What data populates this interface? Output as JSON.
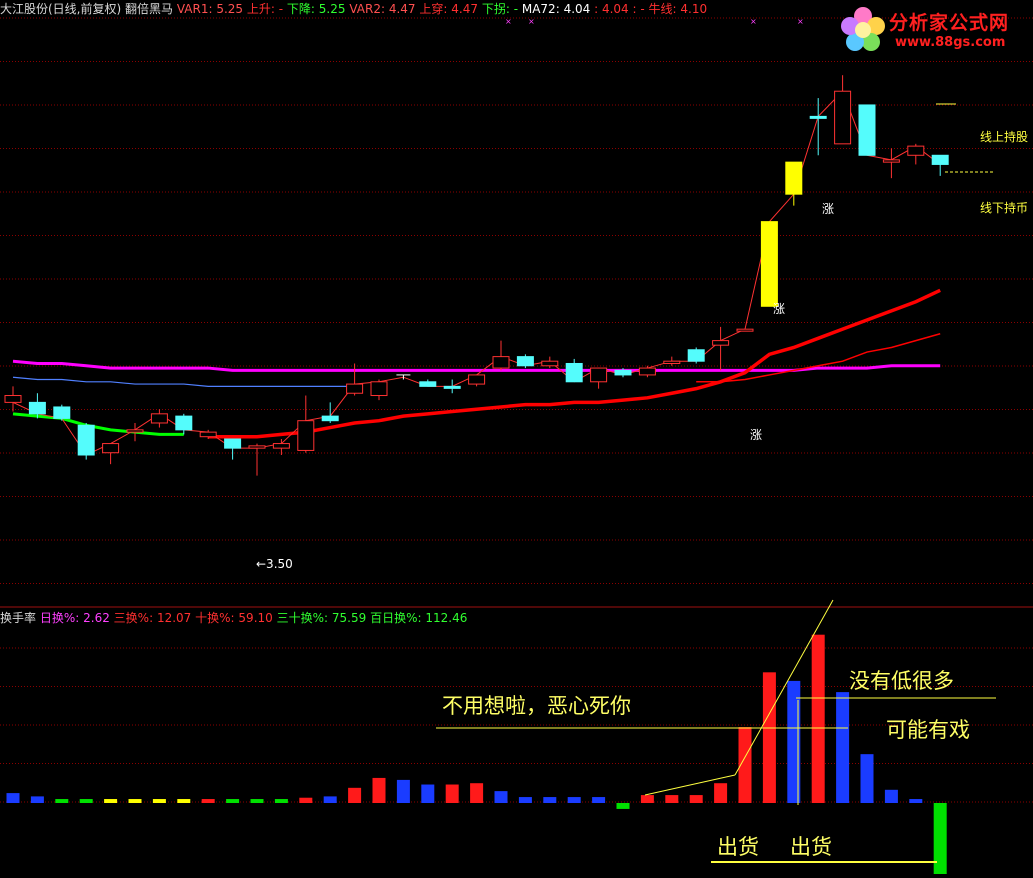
{
  "header": {
    "title": "大江股份(日线,前复权) 翻倍黑马",
    "var1_label": "VAR1:",
    "var1_value": "5.25",
    "up_label": "上升:",
    "up_value": "-",
    "down_label": "下降:",
    "down_value": "5.25",
    "var2_label": "VAR2:",
    "var2_value": "4.47",
    "rise_label": "上穿:",
    "rise_value": "4.47",
    "drop_label": "下拐:",
    "drop_value": "-",
    "ma72_label": "MA72:",
    "ma72_value": "4.04",
    "extra1": ": 4.04",
    "extra2": ": -",
    "bull_label": "牛线:",
    "bull_value": "4.10"
  },
  "sub_header": {
    "title": "换手率",
    "d1_label": "日换%:",
    "d1_value": "2.62",
    "d3_label": "三换%:",
    "d3_value": "12.07",
    "d10_label": "十换%:",
    "d10_value": "59.10",
    "d30_label": "三十换%:",
    "d30_value": "75.59",
    "d100_label": "百日换%:",
    "d100_value": "112.46"
  },
  "logo": {
    "text": "分析家公式网",
    "url": "www.88gs.com"
  },
  "labels": {
    "low_price": "←3.50",
    "zhang1": "涨",
    "zhang2": "涨",
    "zhang3": "涨",
    "hold_stock": "线上持股",
    "hold_cash": "线下持币"
  },
  "annotations": {
    "no_think": "不用想啦，恶心死你",
    "not_low": "没有低很多",
    "maybe": "可能有戏",
    "sell1": "出货",
    "sell2": "出货"
  },
  "colors": {
    "up": "#ff3232",
    "down": "#54fcfc",
    "signal": "#ffff00",
    "ma_purple": "#ff00ff",
    "ma_red": "#ff0000",
    "blue_line": "#5080ff",
    "grid": "#8b0000",
    "green": "#00ff00",
    "yellow_text": "#ffff66"
  },
  "chart_data": [
    {
      "type": "candlestick",
      "title": "大江股份(日线,前复权) 翻倍黑马",
      "ylim": [
        3.0,
        5.5
      ],
      "candles": [
        {
          "o": 3.85,
          "h": 3.89,
          "l": 3.78,
          "c": 3.82,
          "kind": "up"
        },
        {
          "o": 3.82,
          "h": 3.86,
          "l": 3.75,
          "c": 3.77,
          "kind": "down"
        },
        {
          "o": 3.8,
          "h": 3.81,
          "l": 3.74,
          "c": 3.75,
          "kind": "down"
        },
        {
          "o": 3.72,
          "h": 3.73,
          "l": 3.57,
          "c": 3.59,
          "kind": "down"
        },
        {
          "o": 3.6,
          "h": 3.64,
          "l": 3.55,
          "c": 3.64,
          "kind": "up"
        },
        {
          "o": 3.69,
          "h": 3.73,
          "l": 3.65,
          "c": 3.7,
          "kind": "up"
        },
        {
          "o": 3.73,
          "h": 3.79,
          "l": 3.71,
          "c": 3.77,
          "kind": "up"
        },
        {
          "o": 3.76,
          "h": 3.77,
          "l": 3.68,
          "c": 3.7,
          "kind": "down"
        },
        {
          "o": 3.67,
          "h": 3.7,
          "l": 3.66,
          "c": 3.69,
          "kind": "up"
        },
        {
          "o": 3.66,
          "h": 3.66,
          "l": 3.57,
          "c": 3.62,
          "kind": "down"
        },
        {
          "o": 3.63,
          "h": 3.64,
          "l": 3.5,
          "c": 3.62,
          "kind": "up"
        },
        {
          "o": 3.62,
          "h": 3.66,
          "l": 3.59,
          "c": 3.64,
          "kind": "up"
        },
        {
          "o": 3.61,
          "h": 3.85,
          "l": 3.6,
          "c": 3.74,
          "kind": "up"
        },
        {
          "o": 3.74,
          "h": 3.82,
          "l": 3.73,
          "c": 3.76,
          "kind": "down"
        },
        {
          "o": 3.86,
          "h": 3.99,
          "l": 3.85,
          "c": 3.9,
          "kind": "up"
        },
        {
          "o": 3.85,
          "h": 3.92,
          "l": 3.83,
          "c": 3.91,
          "kind": "up"
        },
        {
          "o": 3.94,
          "h": 3.94,
          "l": 3.92,
          "c": 3.93,
          "kind": "cross"
        },
        {
          "o": 3.91,
          "h": 3.92,
          "l": 3.89,
          "c": 3.89,
          "kind": "down"
        },
        {
          "o": 3.89,
          "h": 3.92,
          "l": 3.86,
          "c": 3.89,
          "kind": "down"
        },
        {
          "o": 3.9,
          "h": 3.94,
          "l": 3.89,
          "c": 3.94,
          "kind": "up"
        },
        {
          "o": 3.97,
          "h": 4.09,
          "l": 3.96,
          "c": 4.02,
          "kind": "up"
        },
        {
          "o": 4.02,
          "h": 4.03,
          "l": 3.97,
          "c": 3.98,
          "kind": "down"
        },
        {
          "o": 3.98,
          "h": 4.02,
          "l": 3.97,
          "c": 4.0,
          "kind": "up"
        },
        {
          "o": 3.99,
          "h": 4.01,
          "l": 3.91,
          "c": 3.91,
          "kind": "down"
        },
        {
          "o": 3.91,
          "h": 3.97,
          "l": 3.88,
          "c": 3.97,
          "kind": "up"
        },
        {
          "o": 3.96,
          "h": 3.97,
          "l": 3.93,
          "c": 3.94,
          "kind": "down"
        },
        {
          "o": 3.94,
          "h": 3.98,
          "l": 3.93,
          "c": 3.97,
          "kind": "up"
        },
        {
          "o": 3.99,
          "h": 4.02,
          "l": 3.98,
          "c": 4.0,
          "kind": "up"
        },
        {
          "o": 4.05,
          "h": 4.06,
          "l": 3.99,
          "c": 4.0,
          "kind": "down"
        },
        {
          "o": 4.07,
          "h": 4.15,
          "l": 3.96,
          "c": 4.09,
          "kind": "up"
        },
        {
          "o": 4.14,
          "h": 4.14,
          "l": 4.13,
          "c": 4.14,
          "kind": "up"
        },
        {
          "o": 4.24,
          "h": 4.61,
          "l": 4.24,
          "c": 4.61,
          "kind": "signal"
        },
        {
          "o": 4.87,
          "h": 4.87,
          "l": 4.68,
          "c": 4.73,
          "kind": "signal"
        },
        {
          "o": 5.07,
          "h": 5.15,
          "l": 4.9,
          "c": 5.07,
          "kind": "down"
        },
        {
          "o": 4.95,
          "h": 5.25,
          "l": 4.95,
          "c": 5.18,
          "kind": "up"
        },
        {
          "o": 5.12,
          "h": 5.12,
          "l": 4.9,
          "c": 4.9,
          "kind": "down"
        },
        {
          "o": 4.87,
          "h": 4.93,
          "l": 4.8,
          "c": 4.88,
          "kind": "up"
        },
        {
          "o": 4.9,
          "h": 4.95,
          "l": 4.86,
          "c": 4.94,
          "kind": "up"
        },
        {
          "o": 4.9,
          "h": 4.9,
          "l": 4.81,
          "c": 4.86,
          "kind": "down"
        }
      ],
      "ma_purple": [
        4.0,
        3.99,
        3.99,
        3.98,
        3.97,
        3.97,
        3.97,
        3.97,
        3.97,
        3.96,
        3.96,
        3.96,
        3.96,
        3.96,
        3.96,
        3.96,
        3.96,
        3.96,
        3.96,
        3.96,
        3.96,
        3.96,
        3.96,
        3.96,
        3.96,
        3.96,
        3.96,
        3.96,
        3.96,
        3.96,
        3.96,
        3.96,
        3.96,
        3.97,
        3.97,
        3.97,
        3.98,
        3.98,
        3.98
      ],
      "ma_red_bold": [
        null,
        null,
        null,
        null,
        null,
        null,
        null,
        null,
        3.67,
        3.67,
        3.67,
        3.68,
        3.69,
        3.71,
        3.73,
        3.74,
        3.76,
        3.77,
        3.78,
        3.79,
        3.8,
        3.81,
        3.81,
        3.82,
        3.82,
        3.83,
        3.84,
        3.86,
        3.88,
        3.91,
        3.95,
        4.03,
        4.06,
        4.1,
        4.14,
        4.18,
        4.22,
        4.26,
        4.31
      ],
      "ma_red_thin": [
        null,
        null,
        null,
        null,
        null,
        null,
        null,
        null,
        null,
        null,
        null,
        null,
        null,
        null,
        null,
        null,
        null,
        null,
        null,
        null,
        null,
        null,
        null,
        null,
        null,
        null,
        null,
        null,
        3.91,
        3.91,
        3.92,
        3.94,
        3.96,
        3.98,
        4.0,
        4.04,
        4.06,
        4.09,
        4.12
      ],
      "blue_line": [
        3.93,
        3.92,
        3.92,
        3.91,
        3.91,
        3.9,
        3.9,
        3.9,
        3.89,
        3.89,
        3.89,
        3.89,
        3.89,
        3.89,
        3.89
      ],
      "green_line": [
        3.77,
        3.76,
        3.75,
        3.72,
        3.7,
        3.69,
        3.68,
        3.68
      ]
    },
    {
      "type": "bar",
      "title": "换手率",
      "ylim": [
        0,
        25
      ],
      "values": [
        1.5,
        1.0,
        0.6,
        0.6,
        0.6,
        0.6,
        0.6,
        0.6,
        0.6,
        0.6,
        0.6,
        0.6,
        0.8,
        1.0,
        2.3,
        3.8,
        3.5,
        2.8,
        2.8,
        3.0,
        1.8,
        0.9,
        0.9,
        0.9,
        0.9,
        -0.9,
        1.2,
        1.2,
        1.2,
        3.0,
        11.5,
        19.8,
        18.5,
        25.5,
        16.8,
        7.4,
        2.0,
        0.6,
        -11.0
      ],
      "bar_colors": [
        "blue",
        "blue",
        "green",
        "green",
        "yellow",
        "yellow",
        "yellow",
        "yellow",
        "red",
        "green",
        "green",
        "green",
        "red",
        "blue",
        "red",
        "red",
        "blue",
        "blue",
        "red",
        "red",
        "blue",
        "blue",
        "blue",
        "blue",
        "blue",
        "green",
        "red",
        "red",
        "red",
        "red",
        "red",
        "red",
        "blue",
        "red",
        "blue",
        "blue",
        "blue",
        "blue",
        "green"
      ]
    }
  ]
}
